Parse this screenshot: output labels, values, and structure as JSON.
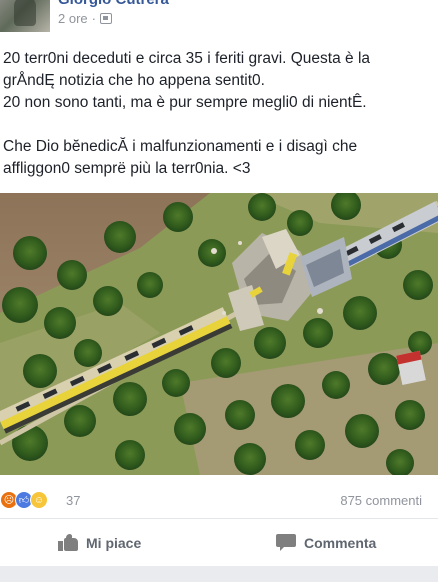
{
  "post": {
    "author": "Giorgio Cutrera",
    "time": "2 ore",
    "time_separator": "·",
    "text_lines": [
      "20 terr0ni deceduti e circa 35 i feriti gravi. Questa è la",
      "grÅndĘ notizia che ho appena sentit0.",
      "20 non sono tanti, ma è pur sempre megli0 di nientÊ.",
      "",
      "Che Dio bĕnedicĂ i malfunzionamenti e i disagì che",
      "affliggon0 semprë più la terr0nia. <3"
    ]
  },
  "photo": {
    "icon": "train-crash-photo"
  },
  "stats": {
    "reaction_icons": [
      "angry-icon",
      "like-icon",
      "haha-icon"
    ],
    "reaction_count": "37",
    "comments_count": "875 commenti"
  },
  "actions": {
    "like_label": "Mi piace",
    "comment_label": "Commenta"
  },
  "colors": {
    "author_link": "#365899",
    "meta_gray": "#90949c",
    "action_gray": "#606770",
    "train_yellow": "#e8d33a",
    "divider": "#e5e6e9"
  }
}
